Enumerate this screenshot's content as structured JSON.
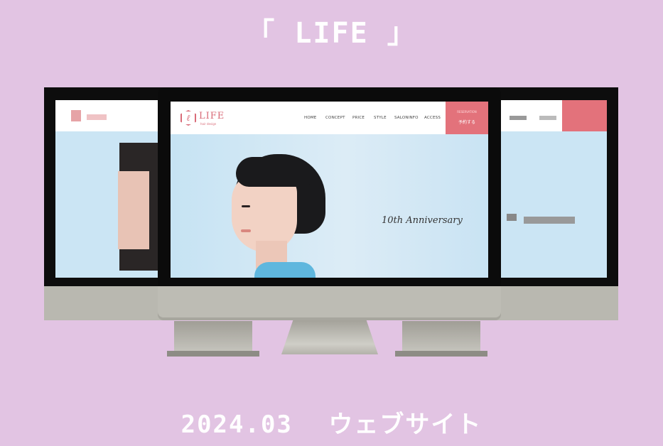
{
  "page": {
    "title": "「 LIFE 」",
    "footer_date": "2024.03",
    "footer_label": "ウェブサイト"
  },
  "site": {
    "brand": "LIFE",
    "brand_sub": "hair design",
    "nav": [
      "HOME",
      "CONCEPT",
      "PRICE",
      "STYLE",
      "SALONINFO",
      "ACCESS"
    ],
    "cta_top": "RESERVATION",
    "cta_label": "予約する",
    "hero_text": "10th Anniversary"
  },
  "colors": {
    "background": "#e2c4e3",
    "accent": "#e3727b",
    "screen": "#cbe5f4"
  }
}
